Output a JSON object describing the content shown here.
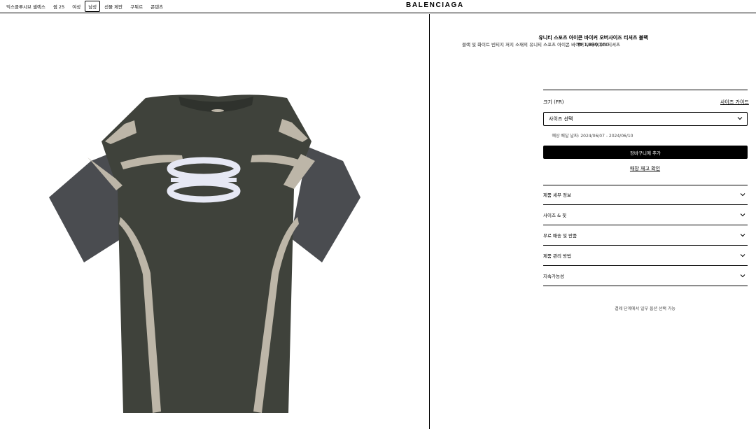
{
  "header": {
    "logo": "BALENCIAGA",
    "nav": [
      {
        "label": "익스클루시브 셀렉스",
        "active": false
      },
      {
        "label": "썸 25",
        "active": false
      },
      {
        "label": "여성",
        "active": false
      },
      {
        "label": "남성",
        "active": true
      },
      {
        "label": "선물 제안",
        "active": false
      },
      {
        "label": "쿠튀르",
        "active": false
      },
      {
        "label": "콘텐츠",
        "active": false
      }
    ]
  },
  "product": {
    "title": "유니티 스포츠 아이콘 바이커 오버사이즈 티셔츠 블랙",
    "price": "₩ 1,830,000",
    "description": "블랙 및 화이트 빈티지 저지 소재의 유니티 스포츠 아이콘 바이커 오버사이즈 티셔츠",
    "image_icon": "oversized-tshirt-image",
    "colors": {
      "body": "#3f423b",
      "sleeve": "#4a4c50",
      "panel": "#bdb6a8",
      "logo": "#e6e8f4"
    }
  },
  "size": {
    "label": "크기 (FR)",
    "guide": "사이즈 가이드",
    "select_placeholder": "사이즈 선택"
  },
  "delivery_text": "예상 배달 날짜: 2024/06/07 - 2024/06/10",
  "cart_button": "장바구니에 추가",
  "stock_link": "매장 재고 확인",
  "accordion": [
    "제품 세부 정보",
    "사이즈 & 핏",
    "무료 배송 및 반품",
    "제품 관리 방법",
    "지속가능성"
  ],
  "payment_note": "결제 단계에서 일부 옵션 선택 가능"
}
